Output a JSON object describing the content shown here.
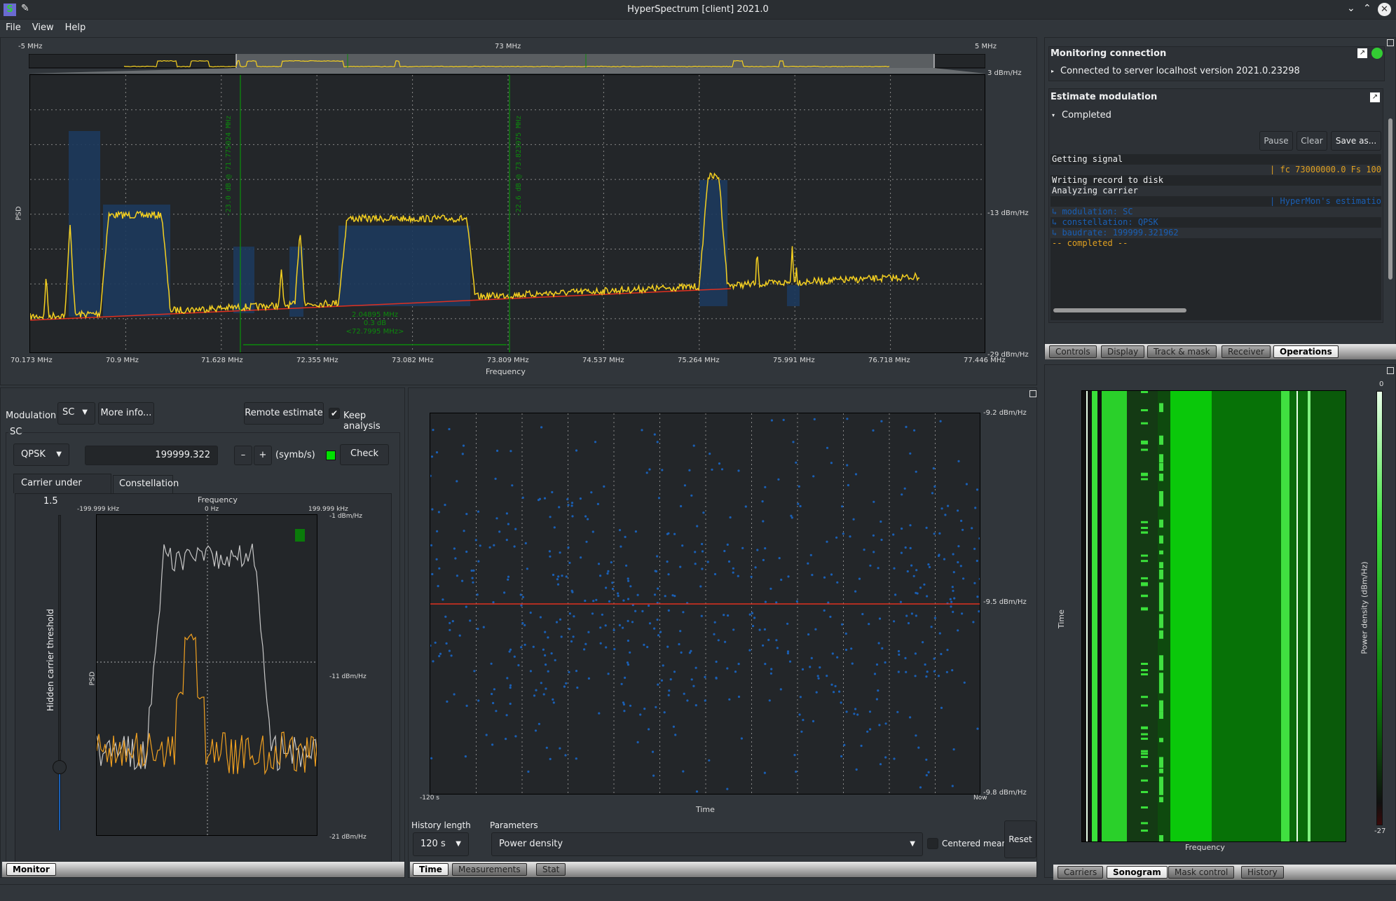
{
  "window": {
    "title": "HyperSpectrum [client] 2021.0"
  },
  "menu": [
    "File",
    "View",
    "Help"
  ],
  "overview": {
    "left_label": "-5 MHz",
    "center_label": "73 MHz",
    "right_label": "5 MHz"
  },
  "spectrum": {
    "ylabel": "PSD",
    "xlabel": "Frequency",
    "x_ticks": [
      "70.173 MHz",
      "70.9 MHz",
      "71.628 MHz",
      "72.355 MHz",
      "73.082 MHz",
      "73.809 MHz",
      "74.537 MHz",
      "75.264 MHz",
      "75.991 MHz",
      "76.718 MHz",
      "77.446 MHz"
    ],
    "y_ticks": [
      "3 dBm/Hz",
      "-13 dBm/Hz",
      "-29 dBm/Hz"
    ],
    "marker1": "-23.0 dB @ 71.775024 MHz",
    "marker2": "-22.6 dB @ 73.823975 MHz",
    "delta": {
      "bandwidth": "2.04895 MHz",
      "level": "0.3 dB",
      "center": "<72.7995 MHz>"
    },
    "colors": {
      "trace": "#f5d020",
      "marker": "#0c8a0c",
      "baseline": "#e03020",
      "carrier": "#1d3a5c"
    }
  },
  "monitoring": {
    "title": "Monitoring connection",
    "status": "Connected to server localhost version 2021.0.23298"
  },
  "estimate": {
    "title": "Estimate modulation",
    "state": "Completed",
    "buttons": {
      "pause": "Pause",
      "clear": "Clear",
      "save": "Save as..."
    },
    "log": [
      {
        "text": "Getting signal",
        "color": "#eff0f1",
        "align": "left"
      },
      {
        "text": "| fc 73000000.0 Fs 100",
        "color": "#e0a020",
        "align": "right"
      },
      {
        "text": "Writing record to disk",
        "color": "#eff0f1",
        "align": "left"
      },
      {
        "text": "Analyzing carrier",
        "color": "#eff0f1",
        "align": "left"
      },
      {
        "text": "| HyperMon's estimatio",
        "color": "#1a5fb4",
        "align": "right"
      },
      {
        "text": " ↳  modulation: SC",
        "color": "#1a5fb4",
        "align": "left"
      },
      {
        "text": " ↳  constellation: QPSK",
        "color": "#1a5fb4",
        "align": "left"
      },
      {
        "text": " ↳  baudrate: 199999.321962",
        "color": "#1a5fb4",
        "align": "left"
      },
      {
        "text": "-- completed --",
        "color": "#e0a020",
        "align": "left"
      }
    ]
  },
  "right_tabs": [
    {
      "label": "Controls",
      "active": false
    },
    {
      "label": "Display",
      "active": false
    },
    {
      "label": "Track & mask",
      "active": false
    },
    {
      "label": "Receiver",
      "active": false
    },
    {
      "label": "Operations",
      "active": true
    }
  ],
  "monitor": {
    "modulation_label": "Modulation",
    "modulation_value": "SC",
    "more_info": "More info...",
    "remote_estimate": "Remote estimate",
    "keep_analysis": "Keep analysis",
    "keep_analysis_checked": true,
    "group_title": "SC",
    "constellation": "QPSK",
    "baudrate": "199999.322",
    "minus": "–",
    "plus": "+",
    "unit": "(symb/s)",
    "check": "Check",
    "indicator_color": "#00e000",
    "subtabs": [
      {
        "label": "Carrier under carrier",
        "active": true
      },
      {
        "label": "Constellation",
        "active": false
      }
    ],
    "threshold_value": "1.5",
    "threshold_label": "Hidden carrier threshold",
    "threshold_level": 0.2,
    "cuc_plot": {
      "xlabel": "Frequency",
      "ylabel": "PSD",
      "x_ticks": [
        "-199.999 kHz",
        "0 Hz",
        "199.999 kHz"
      ],
      "y_ticks": [
        "-1 dBm/Hz",
        "-11 dBm/Hz",
        "-21 dBm/Hz"
      ]
    },
    "tab": "Monitor"
  },
  "time_plot": {
    "xlabel": "Time",
    "x_ticks": [
      "-120 s",
      "Now"
    ],
    "y_ticks": [
      "-9.2 dBm/Hz",
      "-9.5 dBm/Hz",
      "-9.8 dBm/Hz"
    ],
    "mean": -9.5,
    "history_label": "History length",
    "history_value": "120 s",
    "params_label": "Parameters",
    "params_value": "Power density",
    "centered_mean": "Centered mean",
    "reset": "Reset",
    "tabs": [
      {
        "label": "Time",
        "active": true
      },
      {
        "label": "Measurements",
        "active": false
      },
      {
        "label": "Stat",
        "active": false
      }
    ]
  },
  "sonogram": {
    "xlabel": "Frequency",
    "ylabel": "Time",
    "cbar_label": "Power density (dBm/Hz)",
    "cbar_max": "0",
    "cbar_min": "-27",
    "tabs": [
      {
        "label": "Carriers",
        "active": false
      },
      {
        "label": "Sonogram",
        "active": true
      },
      {
        "label": "Mask control",
        "active": false
      },
      {
        "label": "History",
        "active": false
      }
    ]
  }
}
